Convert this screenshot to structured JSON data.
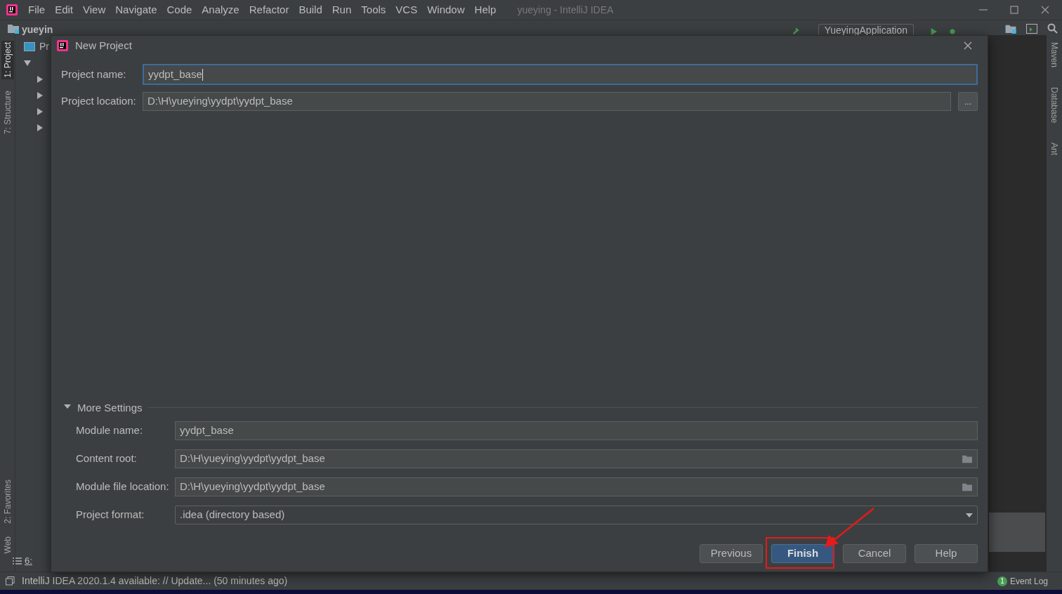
{
  "menu_bar": {
    "items": [
      "File",
      "Edit",
      "View",
      "Navigate",
      "Code",
      "Analyze",
      "Refactor",
      "Build",
      "Run",
      "Tools",
      "VCS",
      "Window",
      "Help"
    ],
    "title": "yueying - IntelliJ IDEA"
  },
  "toolbar": {
    "project": "yueyin",
    "run_config": "YueyingApplication"
  },
  "left_tool_windows": [
    {
      "label": "1: Project",
      "selected": true
    },
    {
      "label": "7: Structure",
      "selected": false
    },
    {
      "label": "2: Favorites",
      "selected": false
    },
    {
      "label": "Web",
      "selected": false
    }
  ],
  "project_panel": {
    "header": "Pr",
    "bottom_tab": "6:"
  },
  "right_tool_windows": [
    "Maven",
    "Database",
    "Ant"
  ],
  "dialog": {
    "title": "New Project",
    "fields": [
      {
        "label": "Project name:",
        "value": "yydpt_base",
        "kind": "text",
        "focused": true
      },
      {
        "label": "Project location:",
        "value": "D:\\H\\yueying\\yydpt\\yydpt_base",
        "kind": "browse",
        "focused": false
      }
    ],
    "more_settings": {
      "label": "More Settings",
      "expanded": true,
      "fields": [
        {
          "label": "Module name:",
          "value": "yydpt_base",
          "kind": "text"
        },
        {
          "label": "Content root:",
          "value": "D:\\H\\yueying\\yydpt\\yydpt_base",
          "kind": "folder"
        },
        {
          "label": "Module file location:",
          "value": "D:\\H\\yueying\\yydpt\\yydpt_base",
          "kind": "folder"
        },
        {
          "label": "Project format:",
          "value": ".idea (directory based)",
          "kind": "dropdown"
        }
      ]
    },
    "browse_button": "...",
    "buttons": [
      {
        "label": "Previous",
        "primary": false
      },
      {
        "label": "Finish",
        "primary": true
      },
      {
        "label": "Cancel",
        "primary": false
      },
      {
        "label": "Help",
        "primary": false
      }
    ]
  },
  "status_bar": {
    "message": "IntelliJ IDEA 2020.1.4 available: // Update... (50 minutes ago)",
    "event_log": {
      "count": "1",
      "label": "Event Log"
    }
  }
}
